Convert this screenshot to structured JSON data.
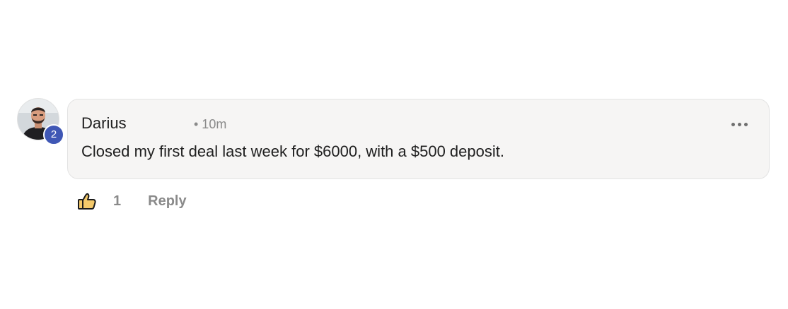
{
  "comment": {
    "author": "Darius",
    "time": "• 10m",
    "text": "Closed my first deal last week for $6000, with a $500 deposit.",
    "level": "2",
    "likes": "1",
    "reply_label": "Reply"
  },
  "icons": {
    "like": "thumbs-up-icon",
    "more": "more-options-icon"
  },
  "colors": {
    "badge": "#3f57b5",
    "bubble": "#f6f5f4",
    "like_fill": "#f4c96a",
    "muted_text": "#8a8a8a"
  }
}
